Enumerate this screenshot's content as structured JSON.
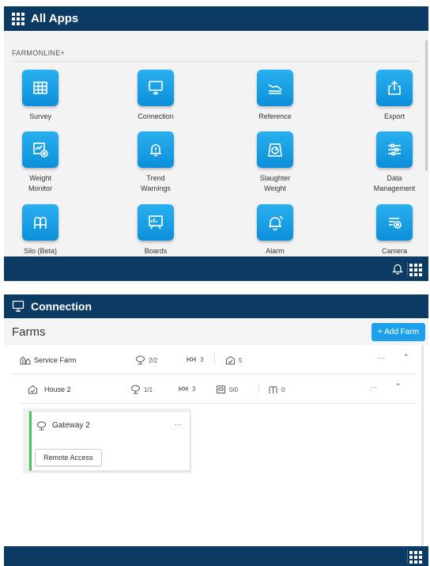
{
  "apps": {
    "title": "All Apps",
    "section": "FARMONLINE+",
    "tiles": [
      {
        "label": "Survey",
        "icon": "table-grid-icon"
      },
      {
        "label": "Connection",
        "icon": "monitor-icon"
      },
      {
        "label": "Reference",
        "icon": "reference-icon"
      },
      {
        "label": "Export",
        "icon": "export-icon"
      },
      {
        "label": "Weight\nMonitor",
        "icon": "weight-monitor-icon"
      },
      {
        "label": "Trend\nWarnings",
        "icon": "trend-warning-icon"
      },
      {
        "label": "Slaughter\nWeight",
        "icon": "scale-icon"
      },
      {
        "label": "Data\nManagement",
        "icon": "sliders-icon"
      },
      {
        "label": "Silo (Beta)",
        "icon": "silo-icon"
      },
      {
        "label": "Boards",
        "icon": "board-icon"
      },
      {
        "label": "Alarm",
        "icon": "alarm-bell-icon"
      },
      {
        "label": "Camera",
        "icon": "camera-icon"
      }
    ]
  },
  "connection": {
    "title": "Connection",
    "farms_title": "Farms",
    "add_farm": "+  Add Farm",
    "farm": {
      "name": "Service Farm",
      "gateways": "2/2",
      "sensors": "3",
      "houses": "5"
    },
    "house": {
      "name": "House 2",
      "gateways": "1/1",
      "sensors": "3",
      "scales": "0/0",
      "silos": "0"
    },
    "gateway": {
      "name": "Gateway 2",
      "button": "Remote Access"
    },
    "menu_dots": "···"
  },
  "colors": {
    "header": "#0b3a63",
    "tile": "#1ea1ea",
    "accent": "#1ea1ea",
    "gateway_status": "#4cc05d"
  }
}
